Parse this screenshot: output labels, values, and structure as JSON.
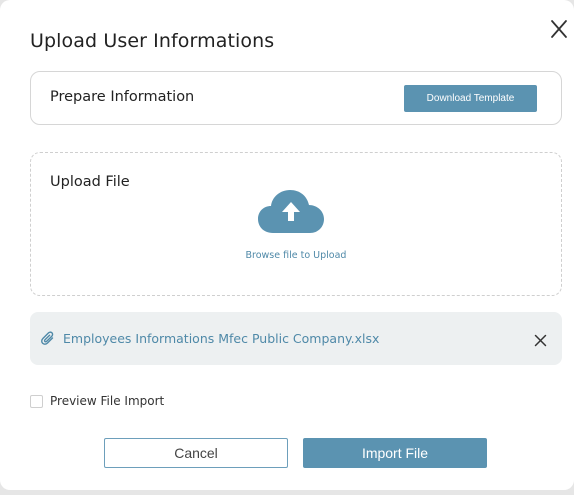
{
  "dialog": {
    "title": "Upload User Informations",
    "close_icon": "close-icon"
  },
  "prepare": {
    "label": "Prepare Information",
    "download_button": "Download Template"
  },
  "upload": {
    "label": "Upload File",
    "icon": "cloud-upload-icon",
    "browse_text": "Browse file to Upload"
  },
  "file": {
    "icon": "paperclip-icon",
    "name": "Employees Informations Mfec Public Company.xlsx",
    "remove_icon": "close-icon"
  },
  "options": {
    "preview_label": "Preview File Import",
    "preview_checked": false
  },
  "actions": {
    "cancel_label": "Cancel",
    "import_label": "Import File"
  },
  "colors": {
    "accent": "#5b93b1",
    "link": "#4f89a8",
    "file_row_bg": "#edf0f1"
  }
}
